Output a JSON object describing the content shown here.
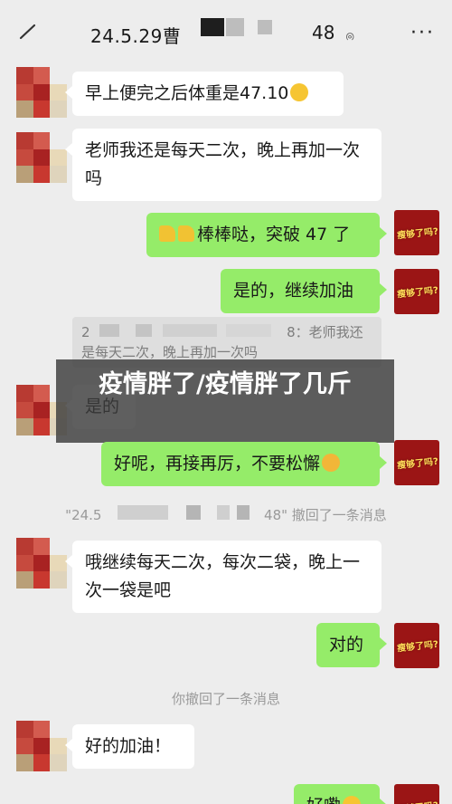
{
  "header": {
    "title_start": "24.5.29曹",
    "title_end": "48",
    "back_icon": "back-arrow-icon",
    "more_icon": "more-icon",
    "ear_icon": "earpiece-icon"
  },
  "messages": {
    "m1": "早上便完之后体重是47.10",
    "m2": "老师我还是每天二次，晚上再加一次吗",
    "m3": "棒棒哒，突破 47 了",
    "m4": "是的，继续加油",
    "quote_line1_start": "2",
    "quote_line1_end": "8：老师我还",
    "quote_line2": "是每天二次，晚上再加一次吗",
    "m5": "是的",
    "m6": "好呢，再接再厉，不要松懈",
    "system1_start": "\"24.5",
    "system1_end": "48\" 撤回了一条消息",
    "m7": "哦继续每天二次，每次二袋，晚上一次一袋是吧",
    "m8": "对的",
    "system2": "你撤回了一条消息",
    "m9": "好的加油！",
    "m10": "好嘞"
  },
  "avatar_sticker": "瘦够了吗?",
  "banner": "疫情胖了/疫情胖了几斤",
  "colors": {
    "outgoing": "#95ec69",
    "incoming": "#ffffff",
    "background": "#ededed",
    "avatar": "#9b1515"
  }
}
